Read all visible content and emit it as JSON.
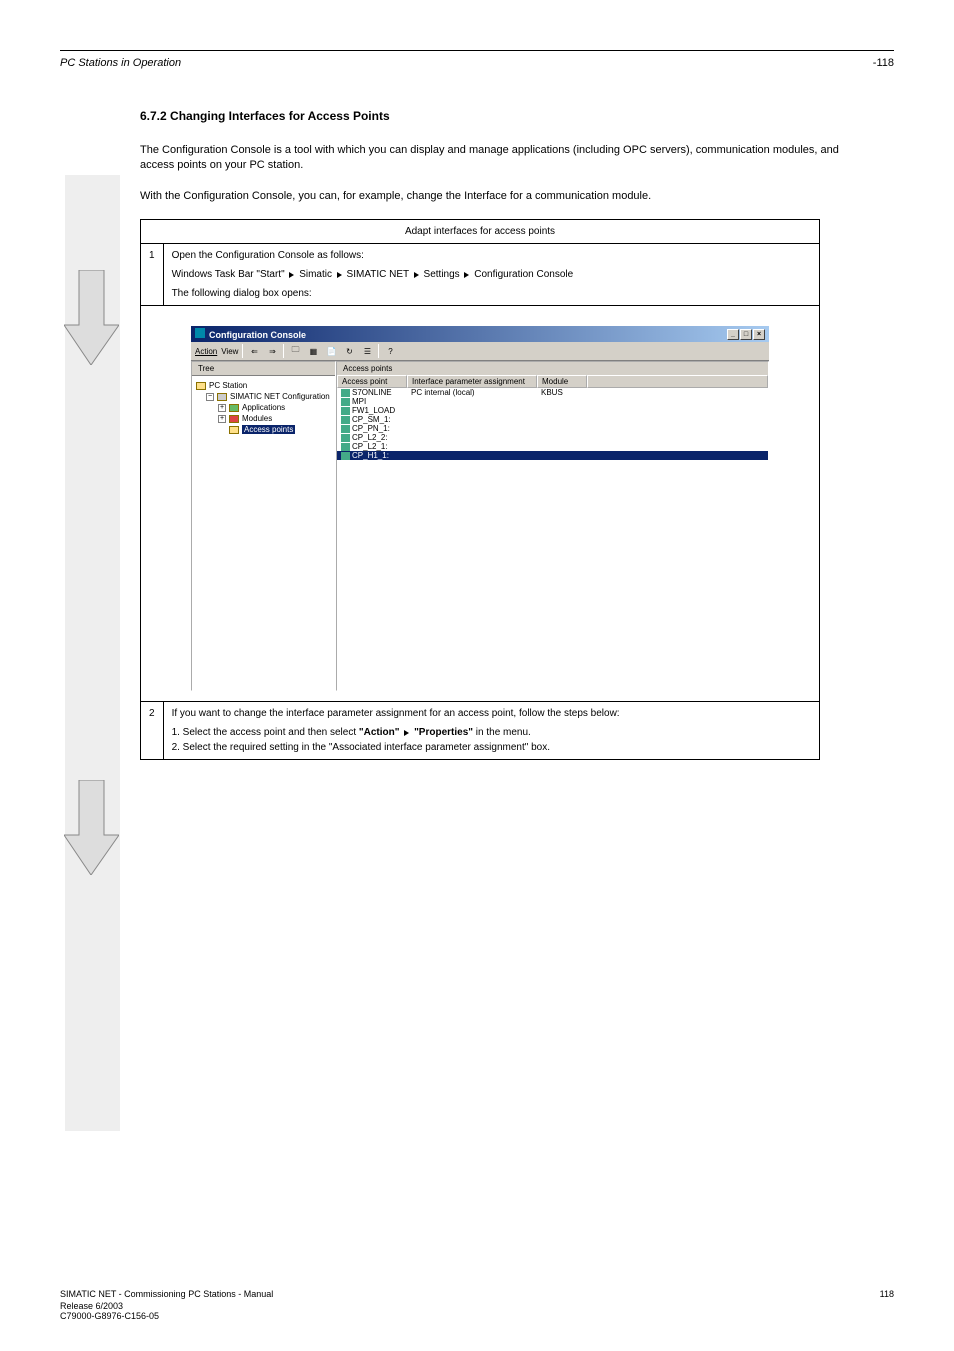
{
  "header": {
    "left": "PC Stations in Operation",
    "right": "-118"
  },
  "section_title": "6.7.2 Changing Interfaces for Access Points",
  "para1": "The Configuration Console is a tool with which you can display and manage applications (including OPC servers), communication modules, and access points on your PC station.",
  "para1b": "With the Configuration Console, you can, for example, change the Interface for a communication module.",
  "table_header": "Adapt interfaces for access points",
  "row1_num": "1",
  "row1_intro": "Open the Configuration Console as follows:",
  "row1_path_prefix": "Windows Task Bar \"Start\"",
  "row1_path_1": "Simatic",
  "row1_path_2": "SIMATIC NET",
  "row1_path_3": "Settings",
  "row1_path_4": "Configuration Console",
  "row1_outro": "The following dialog box opens:",
  "row2_num": "2",
  "row2_intro": "If you want to change the interface parameter assignment for an access point, follow the steps below:",
  "row2_step1_prefix": "1. Select the access point and then select ",
  "row2_step1_menu1": "\"Action\"",
  "row2_step1_menu2": "\"Properties\"",
  "row2_step1_suffix": " in the menu.",
  "row2_step2": "2. Select the required setting in the \"Associated interface parameter assignment\" box.",
  "config_console": {
    "title": "Configuration Console",
    "menu_action": "Action",
    "menu_view": "View",
    "tree_tab": "Tree",
    "tree": {
      "root": "PC Station",
      "simatic": "SIMATIC NET Configuration",
      "applications": "Applications",
      "modules": "Modules",
      "access_points": "Access points"
    },
    "list_title": "Access points",
    "columns": {
      "c1": "Access point",
      "c2": "Interface parameter assignment",
      "c3": "Module",
      "c4": ""
    },
    "rows": [
      {
        "ap": "S7ONLINE",
        "ipa": "PC internal (local)",
        "mod": "KBUS"
      },
      {
        "ap": "MPI",
        "ipa": "",
        "mod": ""
      },
      {
        "ap": "FW1_LOAD",
        "ipa": "",
        "mod": ""
      },
      {
        "ap": "CP_SM_1:",
        "ipa": "",
        "mod": ""
      },
      {
        "ap": "CP_PN_1:",
        "ipa": "",
        "mod": ""
      },
      {
        "ap": "CP_L2_2:",
        "ipa": "",
        "mod": ""
      },
      {
        "ap": "CP_L2_1:",
        "ipa": "",
        "mod": ""
      },
      {
        "ap": "CP_H1_1:",
        "ipa": "",
        "mod": ""
      }
    ]
  },
  "footer": {
    "line1": "SIMATIC NET - Commissioning PC Stations - Manual",
    "line2": "Release 6/2003",
    "code": "C79000-G8976-C156-05",
    "page": "118"
  }
}
